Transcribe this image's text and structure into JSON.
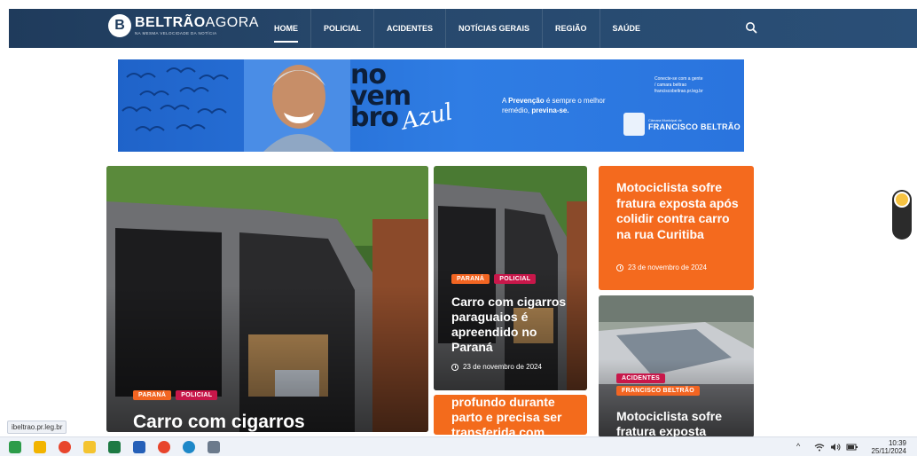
{
  "brand": {
    "logo_mark": "B",
    "title_bold": "BELTRÃO",
    "title_light": "AGORA",
    "tagline": "NA MESMA VELOCIDADE DA NOTÍCIA"
  },
  "nav": {
    "items": [
      {
        "label": "HOME"
      },
      {
        "label": "POLICIAL"
      },
      {
        "label": "ACIDENTES"
      },
      {
        "label": "NOTÍCIAS GERAIS"
      },
      {
        "label": "REGIÃO"
      },
      {
        "label": "SAÚDE"
      }
    ],
    "active_index": 0,
    "search_icon": "search-icon"
  },
  "banner": {
    "line1": "no",
    "line2": "vem",
    "line3": "bro",
    "script": "Azul",
    "prevention_bold": "Prevenção",
    "prevention_text1": "A ",
    "prevention_text2": " é sempre o melhor remédio, ",
    "prevention_bold2": "previna-se.",
    "contact_line1": "Conecte-se com a gente",
    "contact_line2": "/ camara beltrao",
    "contact_line3": "franciscobeltrao.pr.leg.br",
    "camara_small": "Câmara Municipal de",
    "camara_big": "FRANCISCO BELTRÃO"
  },
  "articles": {
    "big": {
      "tags": [
        "PARANÁ",
        "POLICIAL"
      ],
      "headline": "Carro com cigarros"
    },
    "mid": {
      "tags": [
        "PARANÁ",
        "POLICIAL"
      ],
      "headline": "Carro com cigarros paraguaios é apreendido no Paraná",
      "date": "23 de novembro de 2024"
    },
    "mid2": {
      "headline": "profundo durante parto e precisa ser transferida com"
    },
    "orange": {
      "headline": "Motociclista sofre fratura exposta após colidir contra carro na rua Curitiba",
      "date": "23 de novembro de 2024"
    },
    "photo2": {
      "tags": [
        "ACIDENTES",
        "FRANCISCO BELTRÃO"
      ],
      "headline": "Motociclista sofre fratura exposta"
    }
  },
  "status_url": "ibeltrao.pr.leg.br",
  "taskbar": {
    "time": "10:39",
    "date": "25/11/2024",
    "tray_caret": "^"
  },
  "colors": {
    "nav_bg": "#1f3b5c",
    "orange": "#f46a1e",
    "tag_red": "#c8174a",
    "banner_blue": "#2f7de4"
  }
}
